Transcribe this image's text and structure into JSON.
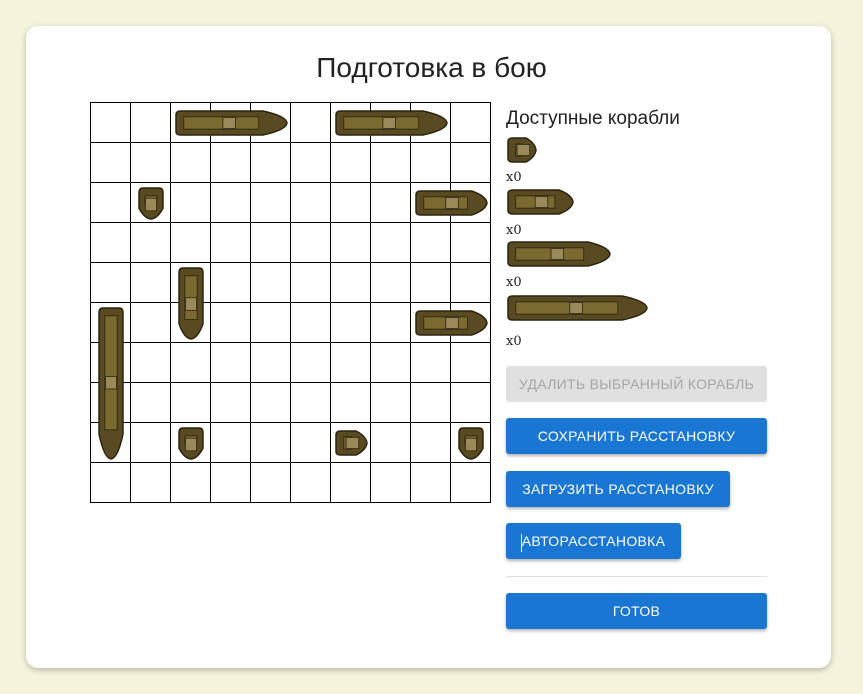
{
  "title": "Подготовка в бою",
  "available": {
    "heading": "Доступные корабли",
    "ships": [
      {
        "size": 1,
        "count": "x0"
      },
      {
        "size": 2,
        "count": "x0"
      },
      {
        "size": 3,
        "count": "x0"
      },
      {
        "size": 4,
        "count": "x0"
      }
    ]
  },
  "buttons": {
    "delete": "УДАЛИТЬ ВЫБРАННЫЙ КОРАБЛЬ",
    "save": "СОХРАНИТЬ РАССТАНОВКУ",
    "load": "ЗАГРУЗИТЬ РАССТАНОВКУ",
    "auto": "АВТОРАССТАНОВКА",
    "ready": "ГОТОВ"
  },
  "board": {
    "rows": 10,
    "cols": 10,
    "ships": [
      {
        "row": 0,
        "col": 2,
        "size": 3,
        "orientation": "horizontal"
      },
      {
        "row": 0,
        "col": 6,
        "size": 3,
        "orientation": "horizontal"
      },
      {
        "row": 2,
        "col": 1,
        "size": 1,
        "orientation": "vertical"
      },
      {
        "row": 2,
        "col": 8,
        "size": 2,
        "orientation": "horizontal"
      },
      {
        "row": 4,
        "col": 2,
        "size": 2,
        "orientation": "vertical"
      },
      {
        "row": 5,
        "col": 0,
        "size": 4,
        "orientation": "vertical"
      },
      {
        "row": 5,
        "col": 8,
        "size": 2,
        "orientation": "horizontal"
      },
      {
        "row": 8,
        "col": 2,
        "size": 1,
        "orientation": "vertical"
      },
      {
        "row": 8,
        "col": 6,
        "size": 1,
        "orientation": "horizontal"
      },
      {
        "row": 8,
        "col": 9,
        "size": 1,
        "orientation": "vertical"
      }
    ]
  },
  "colors": {
    "page_bg": "#f4f4dc",
    "primary": "#1976d2",
    "disabled_bg": "#e0e0e0",
    "disabled_text": "#a6a6a6",
    "hull": "#5a4a22",
    "deck": "#7a6a30",
    "outline": "#2a2410"
  }
}
